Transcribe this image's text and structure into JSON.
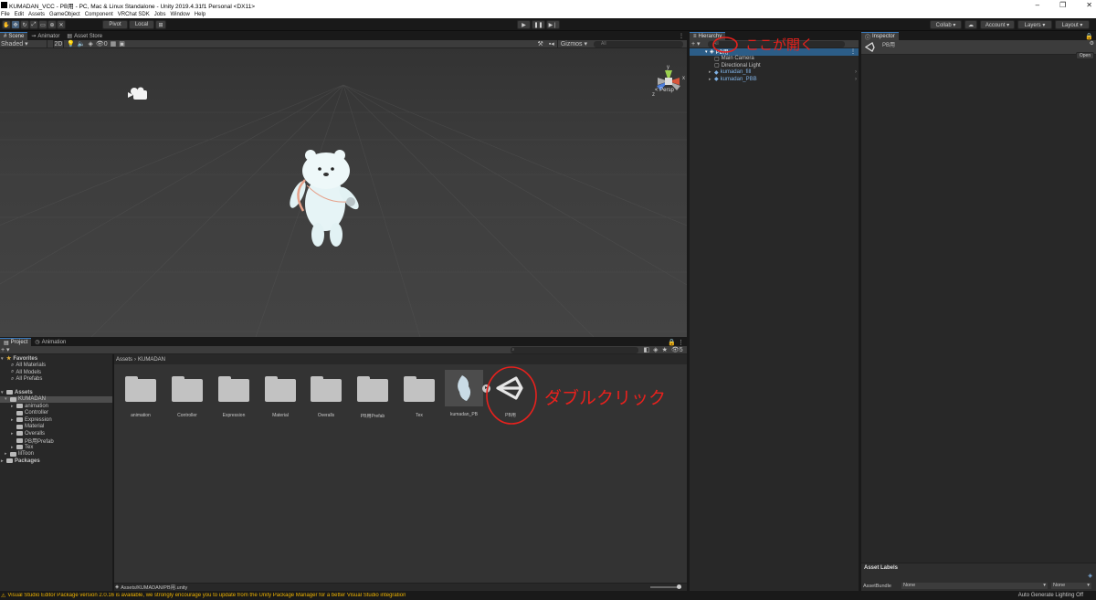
{
  "window": {
    "title": "KUMADAN_VCC - PB用 - PC, Mac & Linux Standalone - Unity 2019.4.31f1 Personal <DX11>",
    "controls": [
      "–",
      "❐",
      "✕"
    ]
  },
  "menu": [
    "File",
    "Edit",
    "Assets",
    "GameObject",
    "Component",
    "VRChat SDK",
    "Jobs",
    "Window",
    "Help"
  ],
  "toolbar": {
    "pivot": "Pivot",
    "local": "Local",
    "collab": "Collab ▾",
    "account": "Account ▾",
    "layers": "Layers ▾",
    "layout": "Layout ▾"
  },
  "scene": {
    "tabs": [
      "Scene",
      "Animator",
      "Asset Store"
    ],
    "shading": "Shaded",
    "mode_2d": "2D",
    "hidden_count": "0",
    "gizmos": "Gizmos ▾",
    "search_placeholder": "All",
    "persp": "< Persp",
    "gizmo_axes": {
      "y": "y",
      "x": "x",
      "z": "z"
    }
  },
  "hierarchy": {
    "tab": "Hierarchy",
    "search_placeholder": "All",
    "scene_name": "PB用",
    "items": [
      {
        "label": "Main Camera",
        "indent": 1
      },
      {
        "label": "Directional Light",
        "indent": 1
      },
      {
        "label": "kumadan_fill",
        "indent": 1
      },
      {
        "label": "kumadan_PBB",
        "indent": 1
      }
    ],
    "annotation": "ここが開く"
  },
  "inspector": {
    "tab": "Inspector",
    "asset_name": "PB用",
    "open_button": "Open",
    "asset_labels": "Asset Labels",
    "assetbundle_label": "AssetBundle",
    "bundle_value": "None",
    "variant_value": "None"
  },
  "project": {
    "tabs": [
      "Project",
      "Animation"
    ],
    "add_button": "+ ▾",
    "search_placeholder": "",
    "visible_count": "5",
    "favorites": {
      "label": "Favorites",
      "items": [
        "All Materials",
        "All Models",
        "All Prefabs"
      ]
    },
    "tree": [
      {
        "label": "Assets",
        "depth": 0,
        "bold": true
      },
      {
        "label": "KUMADAN",
        "depth": 1,
        "selected": true
      },
      {
        "label": "animation",
        "depth": 2
      },
      {
        "label": "Controller",
        "depth": 2
      },
      {
        "label": "Expression",
        "depth": 2
      },
      {
        "label": "Material",
        "depth": 2
      },
      {
        "label": "Overalls",
        "depth": 2
      },
      {
        "label": "PB用Prefab",
        "depth": 2
      },
      {
        "label": "Tex",
        "depth": 2
      },
      {
        "label": "lilToon",
        "depth": 1
      },
      {
        "label": "Packages",
        "depth": 0,
        "bold": true
      }
    ],
    "breadcrumb": [
      "Assets",
      "KUMADAN"
    ],
    "assets": [
      {
        "label": "animation",
        "kind": "folder"
      },
      {
        "label": "Controller",
        "kind": "folder"
      },
      {
        "label": "Expression",
        "kind": "folder"
      },
      {
        "label": "Material",
        "kind": "folder"
      },
      {
        "label": "Overalls",
        "kind": "folder"
      },
      {
        "label": "PB用Prefab",
        "kind": "folder"
      },
      {
        "label": "Tex",
        "kind": "folder"
      },
      {
        "label": "kumadan_PB",
        "kind": "model"
      },
      {
        "label": "PB用",
        "kind": "scene"
      }
    ],
    "annotation": "ダブルクリック",
    "path": "Assets/KUMADAN/PB用.unity"
  },
  "status": {
    "message": "Visual Studio Editor Package version 2.0.16 is available, we strongly encourage you to update from the Unity Package Manager for a better Visual Studio integration",
    "right": "Auto Generate Lighting Off"
  },
  "colors": {
    "selection": "#2c5d87",
    "annotation": "#e8211d",
    "accent": "#3a79bb",
    "warning": "#f0b400"
  }
}
